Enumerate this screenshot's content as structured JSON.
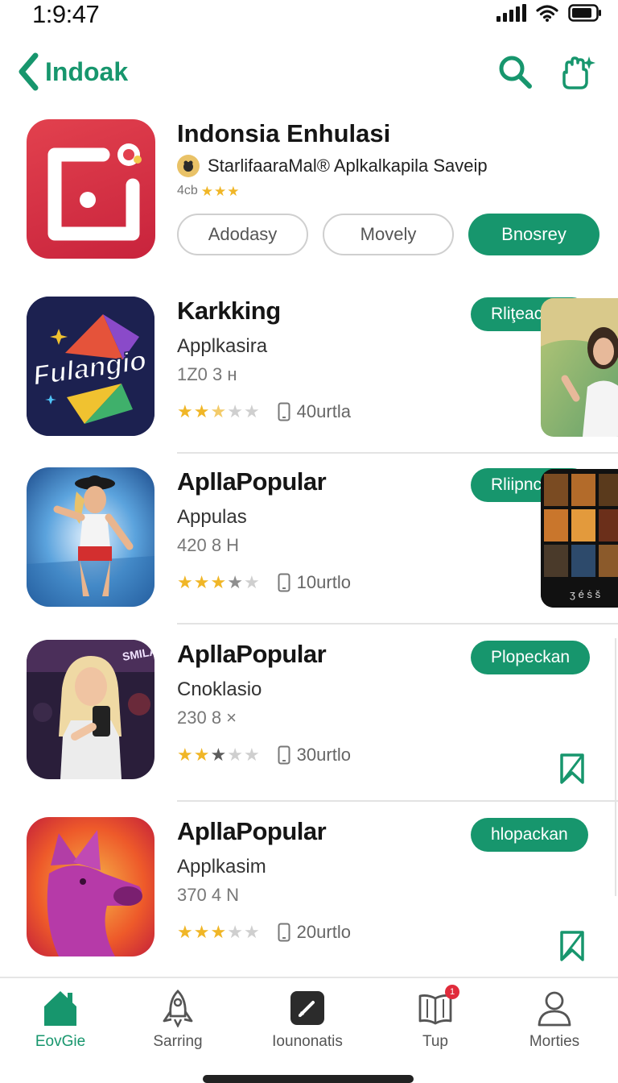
{
  "status_bar": {
    "time": "1:9:47"
  },
  "nav": {
    "back_label": "Indoak"
  },
  "featured": {
    "title": "Indonsia Enhulasi",
    "developer": "StarlifaaraMal® Aplkalkapila Saveip",
    "rating_text": "4cb",
    "stars": 3,
    "buttons": [
      "Adodasy",
      "Movely",
      "Bnosrey"
    ]
  },
  "apps": [
    {
      "name": "Karkking",
      "category": "Applkasira",
      "meta": "1Z0 3 н",
      "stars": 2.5,
      "size": "40urtla",
      "button": "Rliţeackav",
      "icon_text": "Fulangio"
    },
    {
      "name": "ApllaPopular",
      "category": "Appulas",
      "meta": "420 8 H",
      "stars": 3.5,
      "size": "10urtlo",
      "button": "Rliipnckan",
      "thumb_caption": "ӡ é ṡ š"
    },
    {
      "name": "ApllaPopular",
      "category": "Cnoklasio",
      "meta": "230 8 ×",
      "stars": 2.5,
      "size": "30urtlo",
      "button": "Plopeckan",
      "icon_text": "SMILAN"
    },
    {
      "name": "ApllaPopular",
      "category": "Applkasim",
      "meta": "370 4 N",
      "stars": 3,
      "size": "20urtlo",
      "button": "hlopackan"
    }
  ],
  "tabbar": {
    "tabs": [
      {
        "label": "EovGie",
        "icon": "home-icon",
        "active": true
      },
      {
        "label": "Sarring",
        "icon": "rocket-icon"
      },
      {
        "label": "Iounonatis",
        "icon": "edit-icon"
      },
      {
        "label": "Tup",
        "icon": "book-icon",
        "badge": "1"
      },
      {
        "label": "Morties",
        "icon": "person-icon"
      }
    ]
  },
  "colors": {
    "accent": "#17966d",
    "star": "#f0b627",
    "badge": "#e02b3b"
  }
}
